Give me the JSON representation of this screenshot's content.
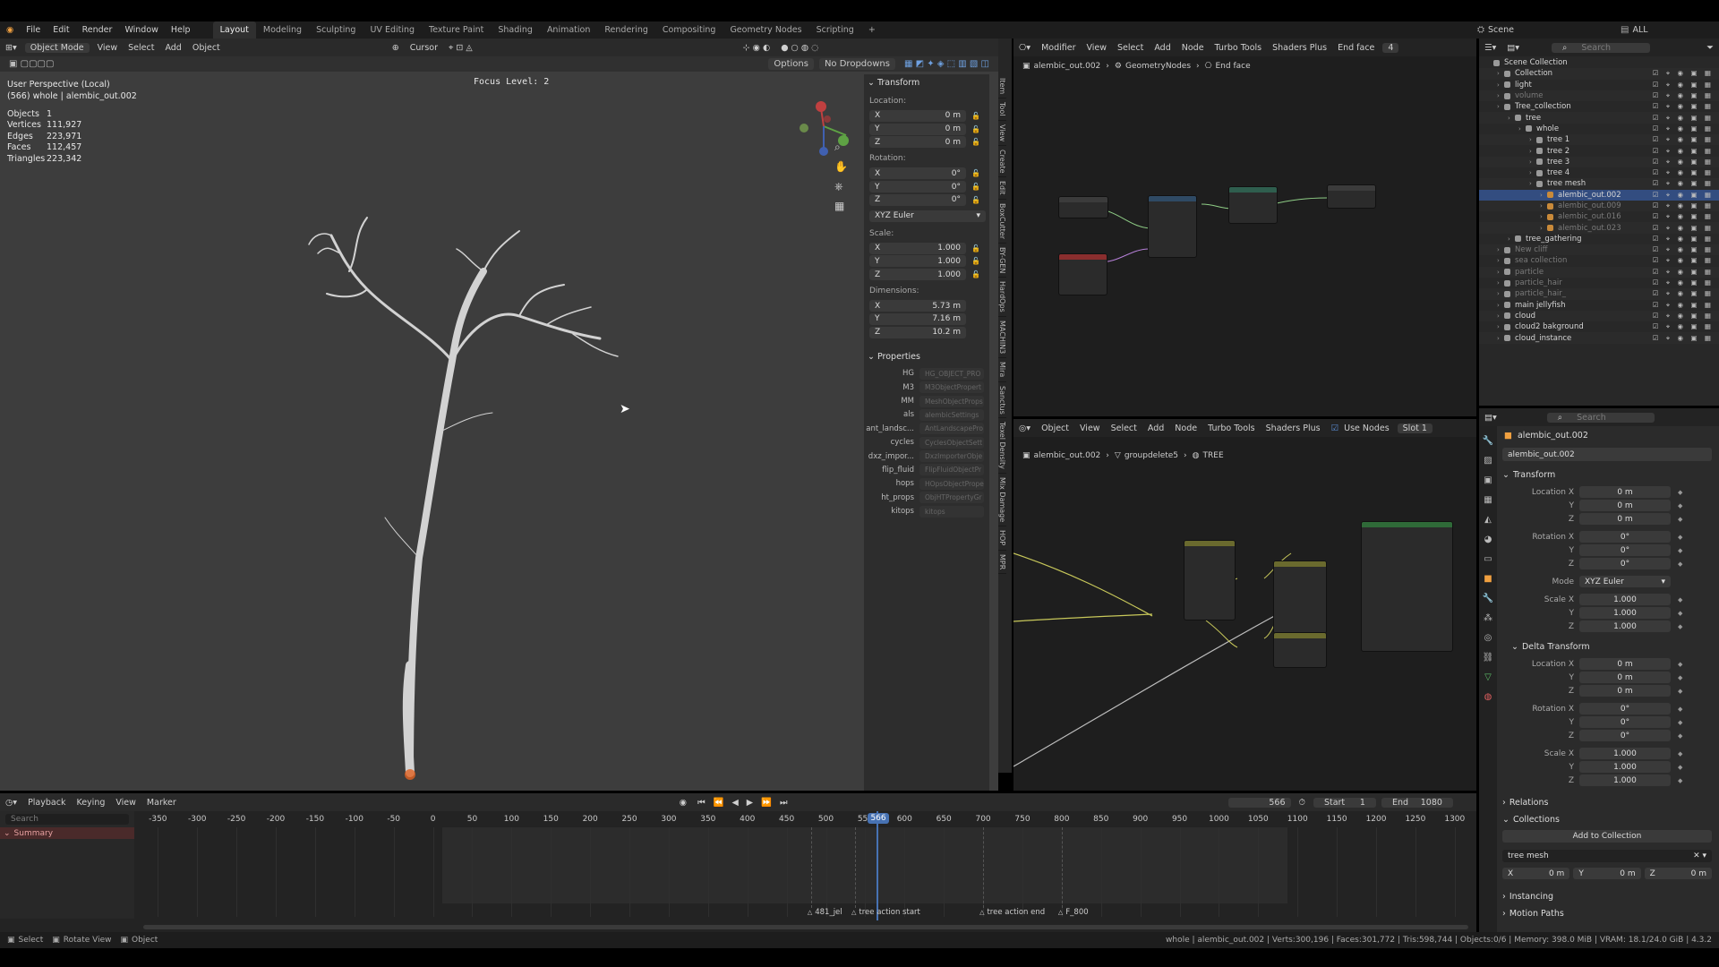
{
  "menu": [
    "File",
    "Edit",
    "Render",
    "Window",
    "Help"
  ],
  "workspaces": [
    "Layout",
    "Modeling",
    "Sculpting",
    "UV Editing",
    "Texture Paint",
    "Shading",
    "Animation",
    "Rendering",
    "Compositing",
    "Geometry Nodes",
    "Scripting"
  ],
  "workspace_add": "+",
  "top_right": {
    "scene": "Scene",
    "view_layer": "ALL"
  },
  "viewport": {
    "mode": "Object Mode",
    "menus": [
      "View",
      "Select",
      "Add",
      "Object"
    ],
    "transform_label": "Cursor",
    "options": "Options",
    "dropdowns": "No Dropdowns",
    "perspective": "User Perspective (Local)",
    "object_info": "(566) whole | alembic_out.002",
    "stats": [
      {
        "k": "Objects",
        "v": "1"
      },
      {
        "k": "Vertices",
        "v": "111,927"
      },
      {
        "k": "Edges",
        "v": "223,971"
      },
      {
        "k": "Faces",
        "v": "112,457"
      },
      {
        "k": "Triangles",
        "v": "223,342"
      }
    ],
    "focus": "Focus Level: 2"
  },
  "npanel": {
    "transform": "Transform",
    "location": "Location:",
    "loc": [
      {
        "a": "X",
        "v": "0 m"
      },
      {
        "a": "Y",
        "v": "0 m"
      },
      {
        "a": "Z",
        "v": "0 m"
      }
    ],
    "rotation": "Rotation:",
    "rot": [
      {
        "a": "X",
        "v": "0°"
      },
      {
        "a": "Y",
        "v": "0°"
      },
      {
        "a": "Z",
        "v": "0°"
      }
    ],
    "rot_mode": "XYZ Euler",
    "scale": "Scale:",
    "scl": [
      {
        "a": "X",
        "v": "1.000"
      },
      {
        "a": "Y",
        "v": "1.000"
      },
      {
        "a": "Z",
        "v": "1.000"
      }
    ],
    "dimensions": "Dimensions:",
    "dim": [
      {
        "a": "X",
        "v": "5.73 m"
      },
      {
        "a": "Y",
        "v": "7.16 m"
      },
      {
        "a": "Z",
        "v": "10.2 m"
      }
    ],
    "properties": "Properties",
    "props": [
      {
        "k": "HG",
        "v": "HG_OBJECT_PRO"
      },
      {
        "k": "M3",
        "v": "M3ObjectPropert"
      },
      {
        "k": "MM",
        "v": "MeshObjectProps"
      },
      {
        "k": "als",
        "v": "alembicSettings"
      },
      {
        "k": "ant_landsc...",
        "v": "AntLandscapePro"
      },
      {
        "k": "cycles",
        "v": "CyclesObjectSett"
      },
      {
        "k": "dxz_impor...",
        "v": "DxzImporterObje"
      },
      {
        "k": "flip_fluid",
        "v": "FlipFluidObjectPr"
      },
      {
        "k": "hops",
        "v": "HOpsObjectProper"
      },
      {
        "k": "ht_props",
        "v": "ObjHTPropertyGr"
      },
      {
        "k": "kitops",
        "v": "kitops"
      }
    ],
    "tabs": [
      "Item",
      "Tool",
      "View",
      "Create",
      "Edit",
      "BoxCutter",
      "BY-GEN",
      "HardOps",
      "MACHIN3",
      "Mira",
      "Sanctus",
      "Texel Density",
      "Mix Damage",
      "HOP",
      "MPR"
    ]
  },
  "gn_editor": {
    "type": "Modifier",
    "menus": [
      "View",
      "Select",
      "Add",
      "Node",
      "Turbo Tools",
      "Shaders Plus"
    ],
    "end": "End face",
    "users": "4",
    "bc": [
      "alembic_out.002",
      "GeometryNodes",
      "End face"
    ]
  },
  "sh_editor": {
    "type": "Object",
    "menus": [
      "View",
      "Select",
      "Add",
      "Node",
      "Turbo Tools",
      "Shaders Plus"
    ],
    "use_nodes": "Use Nodes",
    "slot": "Slot 1",
    "bc": [
      "alembic_out.002",
      "groupdelete5",
      "TREE"
    ]
  },
  "outliner": {
    "search": "Search",
    "rows": [
      {
        "d": 0,
        "t": "Scene Collection",
        "dim": false
      },
      {
        "d": 1,
        "t": "Collection",
        "dim": false
      },
      {
        "d": 1,
        "t": "light",
        "dim": false
      },
      {
        "d": 1,
        "t": "volume",
        "dim": true
      },
      {
        "d": 1,
        "t": "Tree_collection",
        "dim": false
      },
      {
        "d": 2,
        "t": "tree",
        "dim": false
      },
      {
        "d": 3,
        "t": "whole",
        "dim": false
      },
      {
        "d": 4,
        "t": "tree 1",
        "dim": false
      },
      {
        "d": 4,
        "t": "tree 2",
        "dim": false
      },
      {
        "d": 4,
        "t": "tree 3",
        "dim": false
      },
      {
        "d": 4,
        "t": "tree 4",
        "dim": false
      },
      {
        "d": 4,
        "t": "tree mesh",
        "dim": false
      },
      {
        "d": 5,
        "t": "alembic_out.002",
        "dim": false
      },
      {
        "d": 5,
        "t": "alembic_out.009",
        "dim": true
      },
      {
        "d": 5,
        "t": "alembic_out.016",
        "dim": true
      },
      {
        "d": 5,
        "t": "alembic_out.023",
        "dim": true
      },
      {
        "d": 2,
        "t": "tree_gathering",
        "dim": false
      },
      {
        "d": 1,
        "t": "New cliff",
        "dim": true
      },
      {
        "d": 1,
        "t": "sea collection",
        "dim": true
      },
      {
        "d": 1,
        "t": "particle",
        "dim": true
      },
      {
        "d": 1,
        "t": "particle_hair",
        "dim": true
      },
      {
        "d": 1,
        "t": "particle_hair_",
        "dim": true
      },
      {
        "d": 1,
        "t": "main jellyfish",
        "dim": false
      },
      {
        "d": 1,
        "t": "cloud",
        "dim": false
      },
      {
        "d": 1,
        "t": "cloud2 bakground",
        "dim": false
      },
      {
        "d": 1,
        "t": "cloud_instance",
        "dim": false
      }
    ]
  },
  "props": {
    "search": "Search",
    "object": "alembic_out.002",
    "name": "alembic_out.002",
    "transform": "Transform",
    "loc": [
      {
        "a": "Location X",
        "v": "0 m"
      },
      {
        "a": "Y",
        "v": "0 m"
      },
      {
        "a": "Z",
        "v": "0 m"
      }
    ],
    "rot": [
      {
        "a": "Rotation X",
        "v": "0°"
      },
      {
        "a": "Y",
        "v": "0°"
      },
      {
        "a": "Z",
        "v": "0°"
      }
    ],
    "mode_label": "Mode",
    "mode": "XYZ Euler",
    "scl": [
      {
        "a": "Scale X",
        "v": "1.000"
      },
      {
        "a": "Y",
        "v": "1.000"
      },
      {
        "a": "Z",
        "v": "1.000"
      }
    ],
    "delta": "Delta Transform",
    "dloc": [
      {
        "a": "Location X",
        "v": "0 m"
      },
      {
        "a": "Y",
        "v": "0 m"
      },
      {
        "a": "Z",
        "v": "0 m"
      }
    ],
    "drot": [
      {
        "a": "Rotation X",
        "v": "0°"
      },
      {
        "a": "Y",
        "v": "0°"
      },
      {
        "a": "Z",
        "v": "0°"
      }
    ],
    "dscl": [
      {
        "a": "Scale X",
        "v": "1.000"
      },
      {
        "a": "Y",
        "v": "1.000"
      },
      {
        "a": "Z",
        "v": "1.000"
      }
    ],
    "relations": "Relations",
    "collections": "Collections",
    "add_to": "Add to Collection",
    "coll_name": "tree mesh",
    "offs": [
      {
        "a": "X",
        "v": "0 m"
      },
      {
        "a": "Y",
        "v": "0 m"
      },
      {
        "a": "Z",
        "v": "0 m"
      }
    ],
    "instancing": "Instancing",
    "motion": "Motion Paths"
  },
  "timeline": {
    "menus": [
      "Playback",
      "Keying",
      "View",
      "Marker"
    ],
    "frame": "566",
    "start_label": "Start",
    "start": "1",
    "end_label": "End",
    "end": "1080",
    "search": "Search",
    "summary": "Summary",
    "ticks": [
      "-350",
      "-300",
      "-250",
      "-200",
      "-150",
      "-100",
      "-50",
      "0",
      "50",
      "100",
      "150",
      "200",
      "250",
      "300",
      "350",
      "400",
      "450",
      "500",
      "550",
      "600",
      "650",
      "700",
      "750",
      "800",
      "850",
      "900",
      "950",
      "1000",
      "1050",
      "1100",
      "1150",
      "1200",
      "1250",
      "1300"
    ],
    "current": "566",
    "markers": [
      {
        "t": "481_jel",
        "f": 481
      },
      {
        "t": "tree action start",
        "f": 537
      },
      {
        "t": "tree action end",
        "f": 700
      },
      {
        "t": "F_800",
        "f": 800
      }
    ]
  },
  "status": {
    "left": [
      "Select",
      "Rotate View",
      "Object"
    ],
    "right": "whole | alembic_out.002 | Verts:300,196 | Faces:301,772 | Tris:598,744 | Objects:0/6 | Memory: 398.0 MiB | VRAM: 18.1/24.0 GiB | 4.3.2"
  }
}
